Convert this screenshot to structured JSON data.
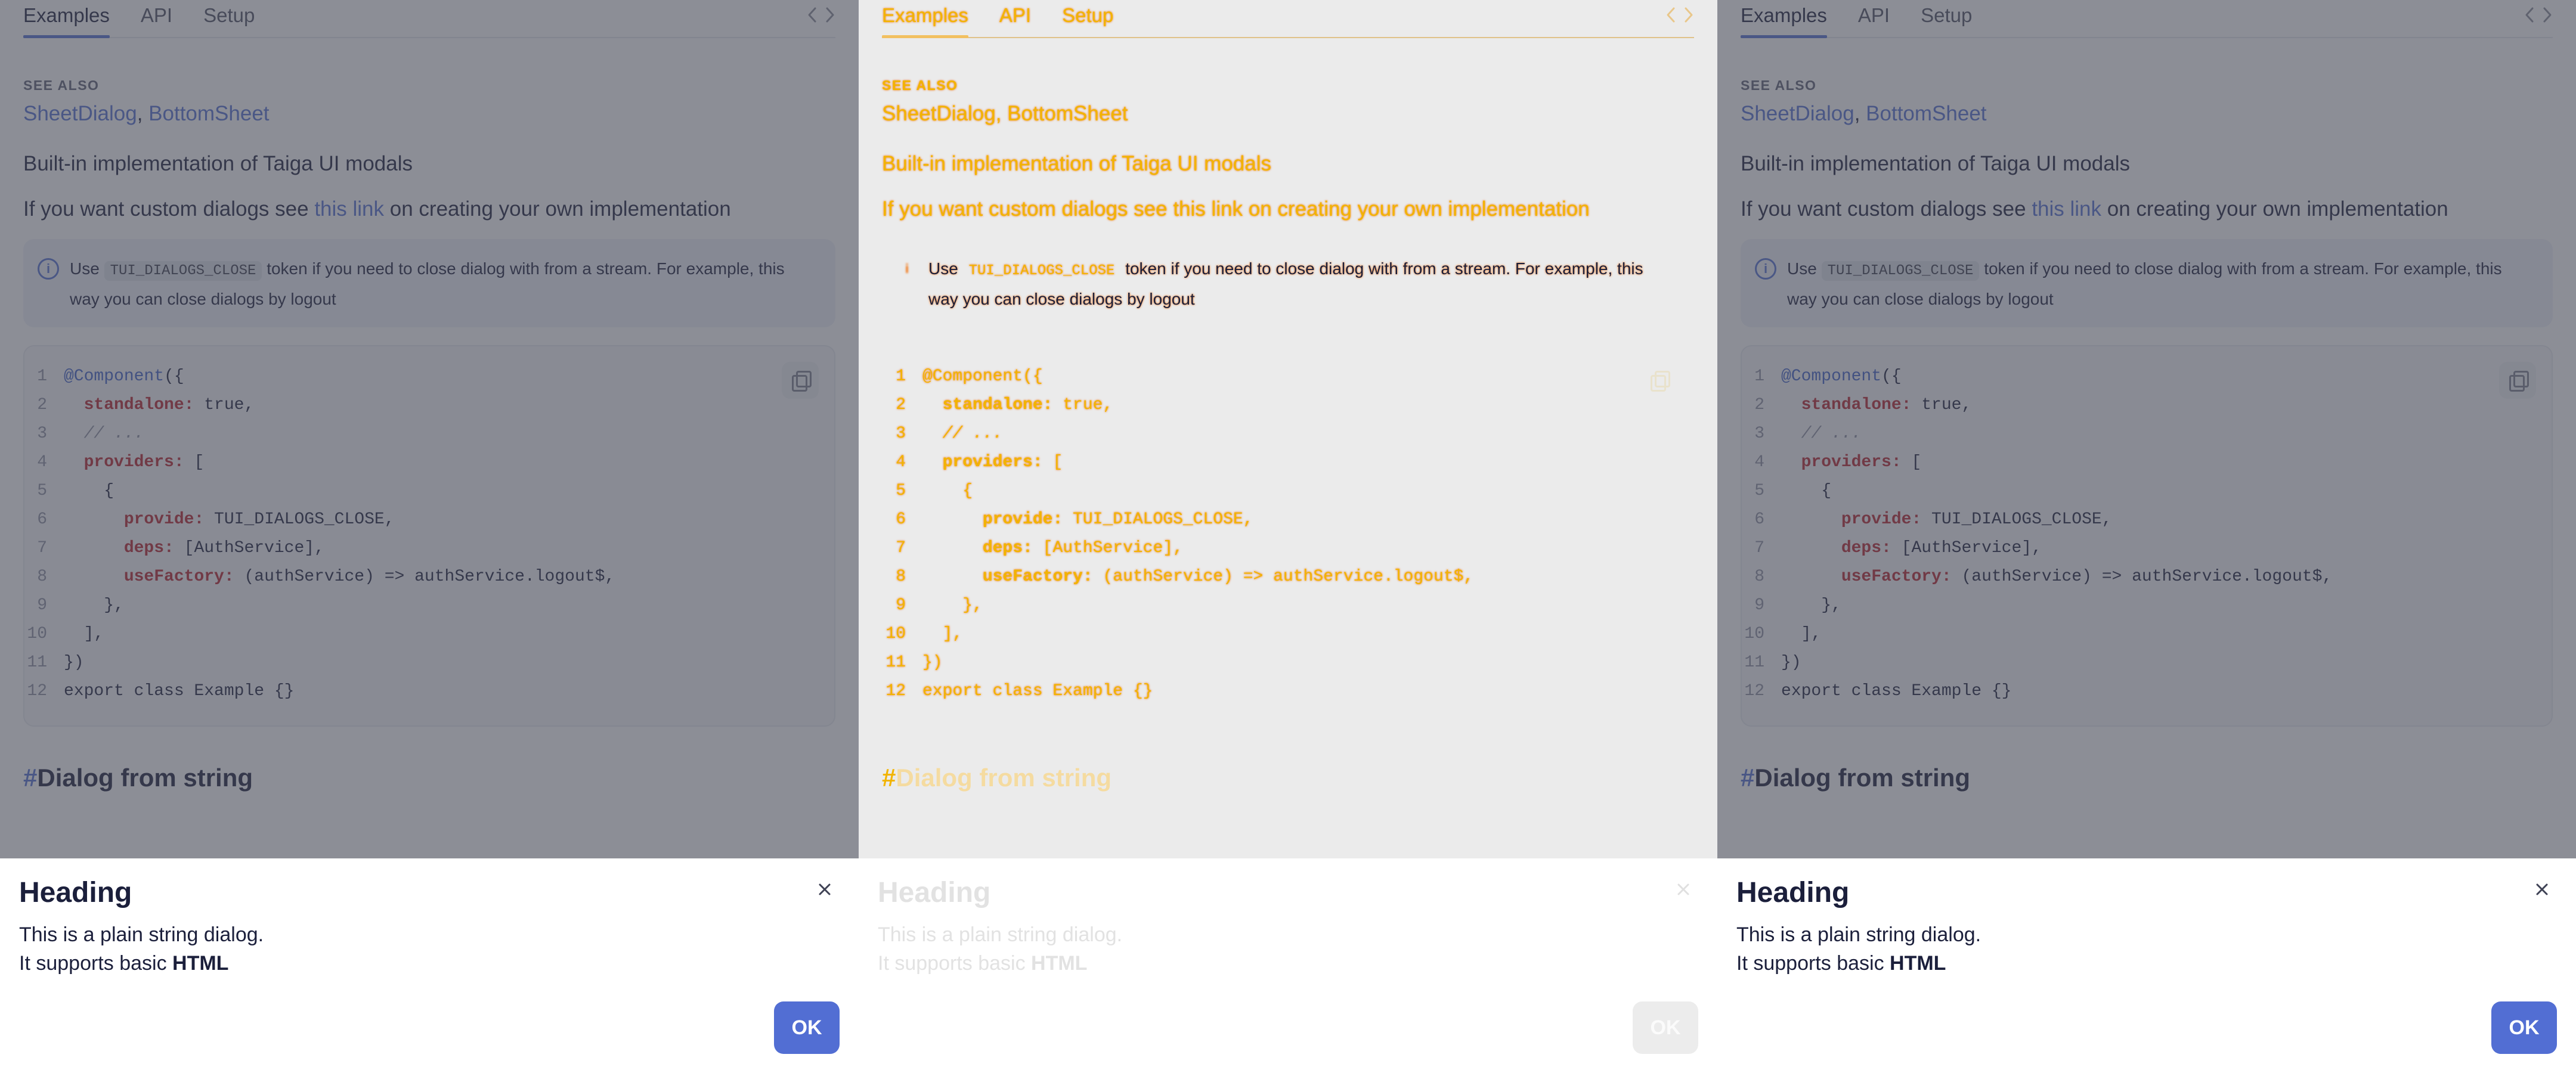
{
  "tabs": [
    {
      "label": "Examples"
    },
    {
      "label": "API"
    },
    {
      "label": "Setup"
    }
  ],
  "see_also": {
    "label": "SEE ALSO",
    "link1": "SheetDialog",
    "separator": ",",
    "link2": "BottomSheet"
  },
  "description": "Built-in implementation of Taiga UI modals",
  "custom_note": {
    "before": "If you want custom dialogs see ",
    "link": "this link",
    "after": " on creating your own implementation"
  },
  "notice": {
    "before": "Use ",
    "code": "TUI_DIALOGS_CLOSE",
    "after": " token if you need to close dialog with from a stream. For example, this way you can close dialogs by logout"
  },
  "code_lines": [
    {
      "n": "1",
      "parts": [
        [
          "dec",
          "@Component"
        ],
        [
          "cd",
          "({"
        ]
      ]
    },
    {
      "n": "2",
      "parts": [
        [
          "cd",
          "  "
        ],
        [
          "key",
          "standalone:"
        ],
        [
          "cd",
          " true,"
        ]
      ]
    },
    {
      "n": "3",
      "parts": [
        [
          "cd",
          "  "
        ],
        [
          "com",
          "// ..."
        ]
      ]
    },
    {
      "n": "4",
      "parts": [
        [
          "cd",
          "  "
        ],
        [
          "key",
          "providers:"
        ],
        [
          "cd",
          " ["
        ]
      ]
    },
    {
      "n": "5",
      "parts": [
        [
          "cd",
          "    {"
        ]
      ]
    },
    {
      "n": "6",
      "parts": [
        [
          "cd",
          "      "
        ],
        [
          "key",
          "provide:"
        ],
        [
          "cd",
          " TUI_DIALOGS_CLOSE,"
        ]
      ]
    },
    {
      "n": "7",
      "parts": [
        [
          "cd",
          "      "
        ],
        [
          "key",
          "deps:"
        ],
        [
          "cd",
          " [AuthService],"
        ]
      ]
    },
    {
      "n": "8",
      "parts": [
        [
          "cd",
          "      "
        ],
        [
          "key",
          "useFactory:"
        ],
        [
          "cd",
          " (authService) => authService.logout$,"
        ]
      ]
    },
    {
      "n": "9",
      "parts": [
        [
          "cd",
          "    },"
        ]
      ]
    },
    {
      "n": "10",
      "parts": [
        [
          "cd",
          "  ],"
        ]
      ]
    },
    {
      "n": "11",
      "parts": [
        [
          "cd",
          "})"
        ]
      ]
    },
    {
      "n": "12",
      "parts": [
        [
          "cd",
          "export class Example {}"
        ]
      ]
    }
  ],
  "section": {
    "hash": "#",
    "title": "Dialog from string"
  },
  "dialog": {
    "heading": "Heading",
    "line1": "This is a plain string dialog.",
    "line2_prefix": "It supports basic ",
    "line2_bold": "HTML",
    "ok_label": "OK",
    "close_icon": "close-icon"
  },
  "colors": {
    "accent": "#526ed3",
    "overlay": "#464856",
    "code_key": "#b9222e",
    "ghost_text": "#f2b400"
  }
}
